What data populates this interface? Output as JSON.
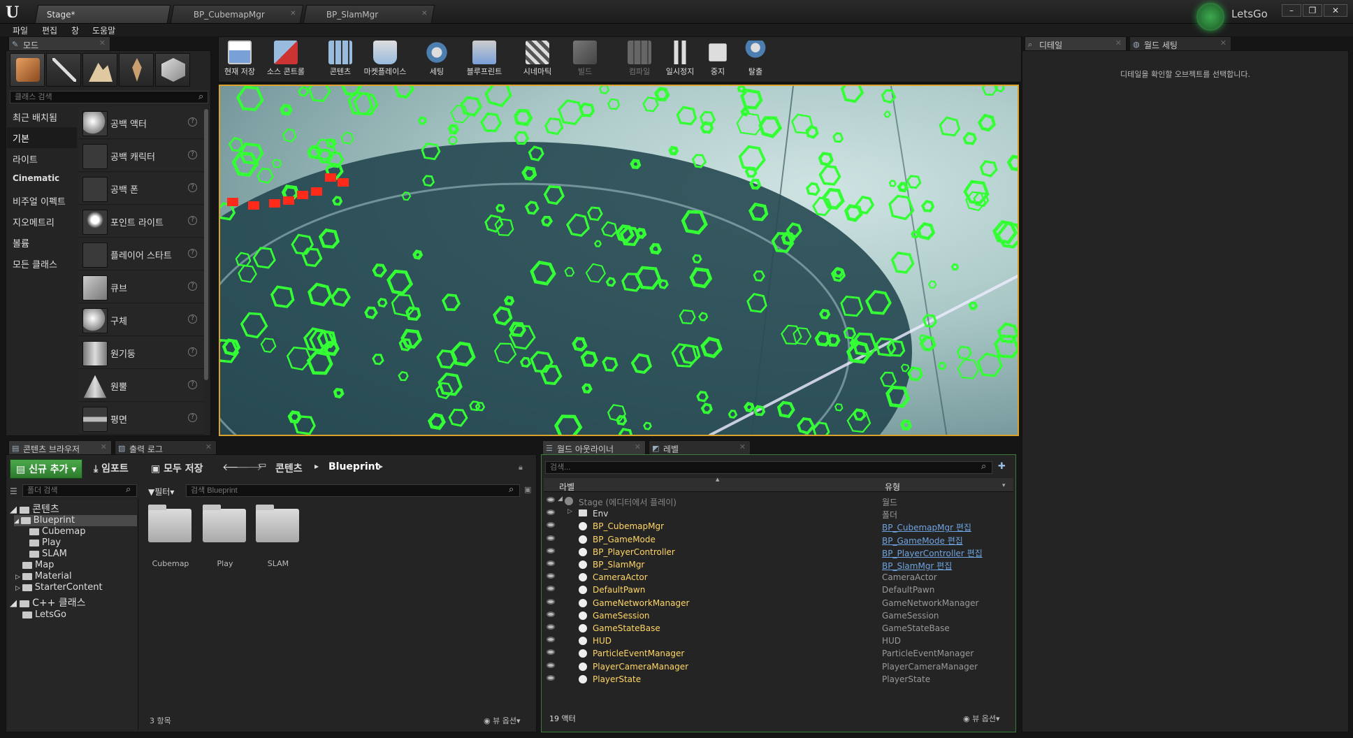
{
  "tabs": [
    {
      "label": "Stage*",
      "active": true
    },
    {
      "label": "BP_CubemapMgr",
      "active": false
    },
    {
      "label": "BP_SlamMgr",
      "active": false
    }
  ],
  "menu": [
    "파일",
    "편집",
    "창",
    "도움말"
  ],
  "profile": {
    "label": "LetsGo"
  },
  "window_buttons": [
    "–",
    "❐",
    "✕"
  ],
  "modes": {
    "tab_label": "모드",
    "search_placeholder": "클래스 검색",
    "categories": [
      "최근 배치됨",
      "기본",
      "라이트",
      "Cinematic",
      "비주얼 이펙트",
      "지오메트리",
      "볼륨",
      "모든 클래스"
    ],
    "active_category": "기본",
    "items": [
      "공백 액터",
      "공백 캐릭터",
      "공백 폰",
      "포인트 라이트",
      "플레이어 스타트",
      "큐브",
      "구체",
      "원기둥",
      "원뿔",
      "평면"
    ]
  },
  "toolbar": [
    {
      "label": "현재 저장",
      "icon": "save-icon",
      "disabled": false
    },
    {
      "label": "소스 콘트롤",
      "icon": "source-control-icon",
      "disabled": false
    },
    {
      "label": "콘텐츠",
      "icon": "content-icon",
      "disabled": false
    },
    {
      "label": "마켓플레이스",
      "icon": "marketplace-icon",
      "disabled": false
    },
    {
      "label": "세팅",
      "icon": "settings-icon",
      "disabled": false
    },
    {
      "label": "블루프린트",
      "icon": "blueprint-icon",
      "disabled": false
    },
    {
      "label": "시네마틱",
      "icon": "cinematic-icon",
      "disabled": false
    },
    {
      "label": "빌드",
      "icon": "build-icon",
      "disabled": true
    },
    {
      "label": "컴파일",
      "icon": "compile-icon",
      "disabled": true
    },
    {
      "label": "일시정지",
      "icon": "pause-icon",
      "disabled": false
    },
    {
      "label": "중지",
      "icon": "stop-icon",
      "disabled": false
    },
    {
      "label": "탈출",
      "icon": "eject-icon",
      "disabled": false
    }
  ],
  "details": {
    "tabs": [
      "디테일",
      "월드 세팅"
    ],
    "message": "디테일을 확인할 오브젝트를 선택합니다."
  },
  "content_browser": {
    "tabs": [
      "콘텐츠 브라우저",
      "출력 로그"
    ],
    "add_new": "신규 추가",
    "import": "임포트",
    "save_all": "모두 저장",
    "breadcrumb": [
      "콘텐츠",
      "Blueprint"
    ],
    "folder_search": "폴더 검색",
    "filter": "필터",
    "search_placeholder": "검색 Blueprint",
    "tree": [
      {
        "label": "콘텐츠",
        "level": 0
      },
      {
        "label": "Blueprint",
        "level": 1,
        "selected": true
      },
      {
        "label": "Cubemap",
        "level": 2
      },
      {
        "label": "Play",
        "level": 2
      },
      {
        "label": "SLAM",
        "level": 2
      },
      {
        "label": "Map",
        "level": 1
      },
      {
        "label": "Material",
        "level": 1
      },
      {
        "label": "StarterContent",
        "level": 1
      },
      {
        "label": "C++ 클래스",
        "level": 0
      },
      {
        "label": "LetsGo",
        "level": 1
      }
    ],
    "folders": [
      "Cubemap",
      "Play",
      "SLAM"
    ],
    "count": "3 항목",
    "view_options": "뷰 옵션"
  },
  "outliner": {
    "tabs": [
      "월드 아웃라이너",
      "레벨"
    ],
    "search_placeholder": "검색...",
    "col_label": "라벨",
    "col_type": "유형",
    "rows": [
      {
        "label": "Stage (에디터에서 플레이)",
        "type": "월드",
        "link": false,
        "root": true
      },
      {
        "label": "Env",
        "type": "폴더",
        "link": false,
        "folder": true
      },
      {
        "label": "BP_CubemapMgr",
        "type": "BP_CubemapMgr 편집",
        "link": true
      },
      {
        "label": "BP_GameMode",
        "type": "BP_GameMode 편집",
        "link": true
      },
      {
        "label": "BP_PlayerController",
        "type": "BP_PlayerController 편집",
        "link": true
      },
      {
        "label": "BP_SlamMgr",
        "type": "BP_SlamMgr 편집",
        "link": true
      },
      {
        "label": "CameraActor",
        "type": "CameraActor",
        "link": false
      },
      {
        "label": "DefaultPawn",
        "type": "DefaultPawn",
        "link": false
      },
      {
        "label": "GameNetworkManager",
        "type": "GameNetworkManager",
        "link": false
      },
      {
        "label": "GameSession",
        "type": "GameSession",
        "link": false
      },
      {
        "label": "GameStateBase",
        "type": "GameStateBase",
        "link": false
      },
      {
        "label": "HUD",
        "type": "HUD",
        "link": false
      },
      {
        "label": "ParticleEventManager",
        "type": "ParticleEventManager",
        "link": false
      },
      {
        "label": "PlayerCameraManager",
        "type": "PlayerCameraManager",
        "link": false
      },
      {
        "label": "PlayerState",
        "type": "PlayerState",
        "link": false
      }
    ],
    "count": "19 액터",
    "view_options": "뷰 옵션"
  },
  "colors": {
    "accent_green": "#34ff34",
    "feature_red": "#ff2a1a",
    "viewport_border": "#d9a22a"
  }
}
